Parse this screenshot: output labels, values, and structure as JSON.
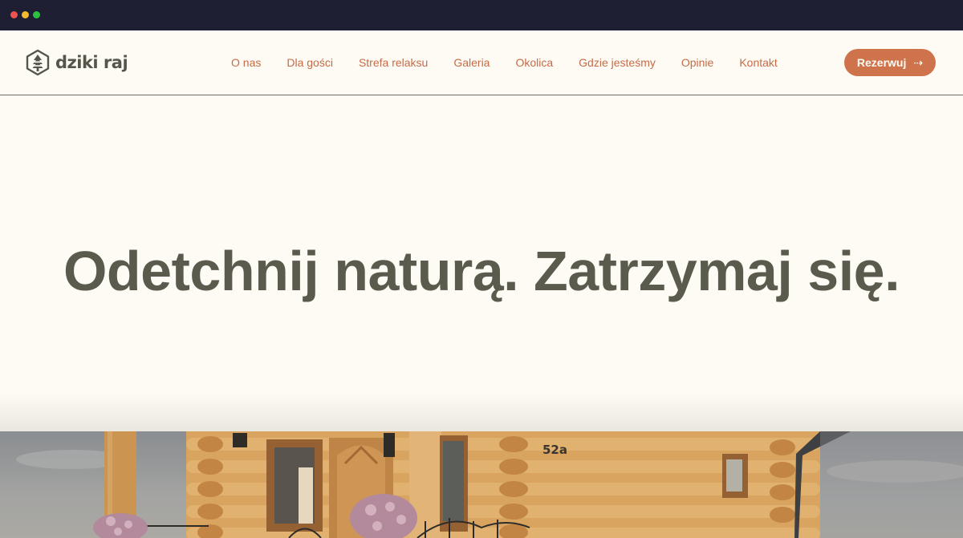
{
  "browser": {
    "controls": [
      "close",
      "minimize",
      "maximize"
    ]
  },
  "brand": {
    "name": "dziki raj",
    "logo_icon": "tree-house-icon"
  },
  "nav": {
    "items": [
      {
        "label": "O nas"
      },
      {
        "label": "Dla gości"
      },
      {
        "label": "Strefa relaksu"
      },
      {
        "label": "Galeria"
      },
      {
        "label": "Okolica"
      },
      {
        "label": "Gdzie jesteśmy"
      },
      {
        "label": "Opinie"
      },
      {
        "label": "Kontakt"
      }
    ]
  },
  "cta": {
    "label": "Rezerwuj",
    "icon": "arrow-right-icon",
    "color": "#cf734d"
  },
  "hero": {
    "title": "Odetchnij naturą. Zatrzymaj się.",
    "image_text": "52a"
  },
  "colors": {
    "accent": "#cf734d",
    "text": "#5a5b4c",
    "background": "#fdfbf4"
  }
}
